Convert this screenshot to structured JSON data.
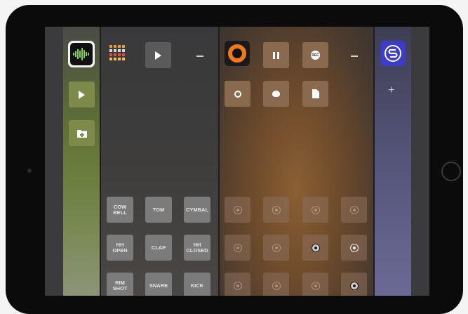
{
  "left_strip": {
    "app_icon_label": "",
    "play_label": "",
    "folder_label": ""
  },
  "drum_panel": {
    "minus_label": "",
    "pads": [
      {
        "label": "COW\nBELL"
      },
      {
        "label": "TOM"
      },
      {
        "label": "CYMBAL"
      },
      {
        "label": "HH\nOPEN"
      },
      {
        "label": "CLAP"
      },
      {
        "label": "HH\nCLOSED"
      },
      {
        "label": "RIM\nSHOT"
      },
      {
        "label": "SNARE"
      },
      {
        "label": "KICK"
      }
    ]
  },
  "transport_panel": {
    "rec_label": "REC",
    "pad_states": [
      "idle",
      "idle",
      "idle",
      "idle",
      "idle",
      "idle",
      "dark",
      "active",
      "idle",
      "idle",
      "idle",
      "dark"
    ]
  },
  "right_strip": {
    "plus_label": "+"
  },
  "colors": {
    "accent_orange": "#f07a1a",
    "sampler_blue": "#3c3cc8"
  }
}
